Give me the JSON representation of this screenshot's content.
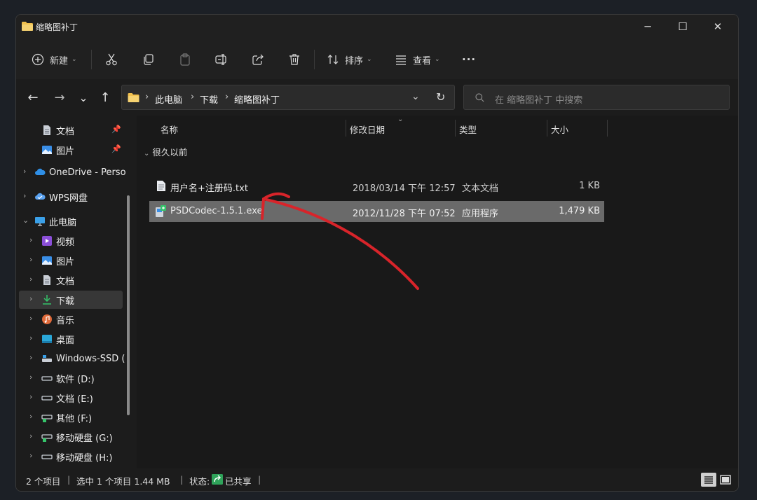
{
  "window": {
    "title": "缩略图补丁",
    "controls": {
      "minimize": "─",
      "maximize": "☐",
      "close": "✕"
    }
  },
  "toolbar": {
    "new_label": "新建",
    "sort_label": "排序",
    "view_label": "查看",
    "more_label": "···",
    "icons": [
      "plus-circle-icon",
      "cut-icon",
      "copy-icon",
      "paste-icon",
      "rename-icon",
      "share-icon",
      "delete-icon",
      "sort-icon",
      "view-icon",
      "more-icon"
    ]
  },
  "nav": {
    "back": "←",
    "forward": "→",
    "recent": "⌄",
    "up": "↑",
    "breadcrumb": [
      "此电脑",
      "下载",
      "缩略图补丁"
    ],
    "search_placeholder": "在 缩略图补丁 中搜索"
  },
  "sidebar": {
    "items": [
      {
        "label": "文档",
        "icon": "document-icon",
        "pinned": true
      },
      {
        "label": "图片",
        "icon": "pictures-icon",
        "pinned": true
      },
      {
        "label": "OneDrive - Perso",
        "icon": "onedrive-icon"
      },
      {
        "label": "WPS网盘",
        "icon": "wps-cloud-icon"
      },
      {
        "label": "此电脑",
        "icon": "this-pc-icon",
        "expanded": true
      },
      {
        "label": "视频",
        "icon": "videos-icon"
      },
      {
        "label": "图片",
        "icon": "pictures-icon"
      },
      {
        "label": "文档",
        "icon": "document-icon"
      },
      {
        "label": "下载",
        "icon": "downloads-icon",
        "selected": true
      },
      {
        "label": "音乐",
        "icon": "music-icon"
      },
      {
        "label": "桌面",
        "icon": "desktop-icon"
      },
      {
        "label": "Windows-SSD (",
        "icon": "system-drive-icon"
      },
      {
        "label": "软件 (D:)",
        "icon": "drive-icon"
      },
      {
        "label": "文档 (E:)",
        "icon": "drive-icon"
      },
      {
        "label": "其他 (F:)",
        "icon": "shared-drive-icon"
      },
      {
        "label": "移动硬盘 (G:)",
        "icon": "shared-drive-icon"
      },
      {
        "label": "移动硬盘 (H:)",
        "icon": "drive-icon"
      }
    ]
  },
  "columns": {
    "name": "名称",
    "date": "修改日期",
    "type": "类型",
    "size": "大小"
  },
  "group": {
    "label": "很久以前"
  },
  "files": [
    {
      "name": "用户名+注册码.txt",
      "date": "2018/03/14 下午 12:57",
      "type": "文本文档",
      "size": "1 KB",
      "icon": "text-file-icon"
    },
    {
      "name": "PSDCodec-1.5.1.exe",
      "date": "2012/11/28 下午 07:52",
      "type": "应用程序",
      "size": "1,479 KB",
      "icon": "installer-icon",
      "selected": true
    }
  ],
  "status": {
    "count": "2 个项目",
    "selection": "选中 1 个项目  1.44 MB",
    "state_label": "状态:",
    "shared": "已共享"
  },
  "colors": {
    "annotation": "#d8242a",
    "selection": "#6a6a6a",
    "accent_folder": "#f2c14e"
  }
}
